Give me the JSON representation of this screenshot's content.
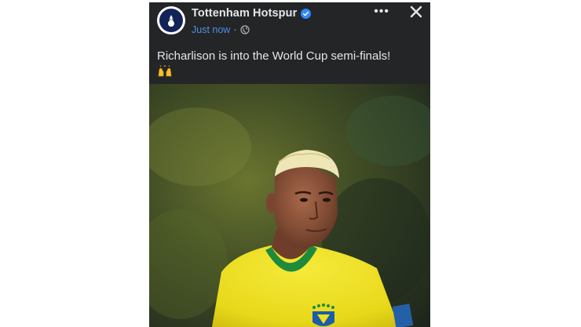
{
  "post": {
    "page_name": "Tottenham Hotspur",
    "timestamp": "Just now",
    "separator": "·",
    "more_label": "•••",
    "caption": "Richarlison is into the World Cup semi-finals!",
    "emoji": "raised-hands-emoji",
    "icons": {
      "verified": "verified-badge-icon",
      "privacy": "globe-icon",
      "close": "close-icon",
      "more": "more-options-icon"
    },
    "colors": {
      "background": "#242526",
      "text_primary": "#e4e6eb",
      "timestamp": "#4f8ee8",
      "verified": "#2d88ff",
      "jersey": "#f2e01e",
      "collar": "#1e8a3c"
    }
  }
}
